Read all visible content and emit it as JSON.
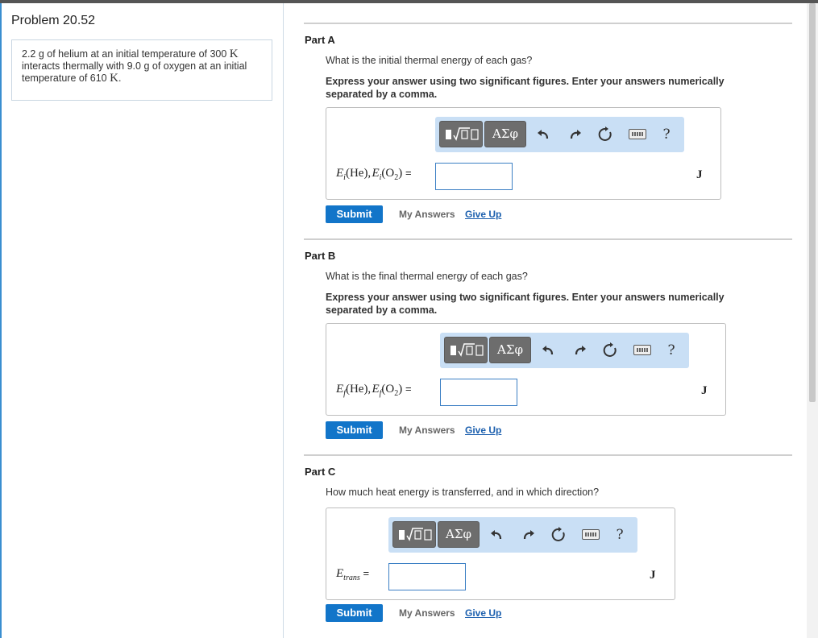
{
  "problem": {
    "title": "Problem 20.52",
    "line1_pre": "2.2 g of helium at an initial temperature of 300 ",
    "line1_unit": "K",
    "line2": "interacts thermally with 9.0 g of oxygen at an initial",
    "line3_pre": "temperature of 610 ",
    "line3_unit": "K",
    "line3_post": "."
  },
  "toolbar": {
    "greek_label": "ΑΣφ",
    "help_label": "?"
  },
  "common": {
    "submit_label": "Submit",
    "my_answers_label": "My Answers",
    "give_up_label": "Give Up",
    "equals": "="
  },
  "parts": [
    {
      "label": "Part A",
      "question": "What is the initial thermal energy of each gas?",
      "instruction": "Express your answer using two significant figures. Enter your answers numerically separated by a comma.",
      "equation_label": "E_i(He), E_i(O2)",
      "unit": "J",
      "answer_value": ""
    },
    {
      "label": "Part B",
      "question": "What is the final thermal energy of each gas?",
      "instruction": "Express your answer using two significant figures. Enter your answers numerically separated by a comma.",
      "equation_label": "E_f(He), E_f(O2)",
      "unit": "J",
      "answer_value": ""
    },
    {
      "label": "Part C",
      "question": "How much heat energy is transferred, and in which direction?",
      "instruction": "",
      "equation_label": "E_trans",
      "unit": "J",
      "answer_value": ""
    }
  ],
  "colors": {
    "submit": "#1275c9",
    "toolbar_bg": "#c9dff5",
    "link": "#1b5fae"
  }
}
